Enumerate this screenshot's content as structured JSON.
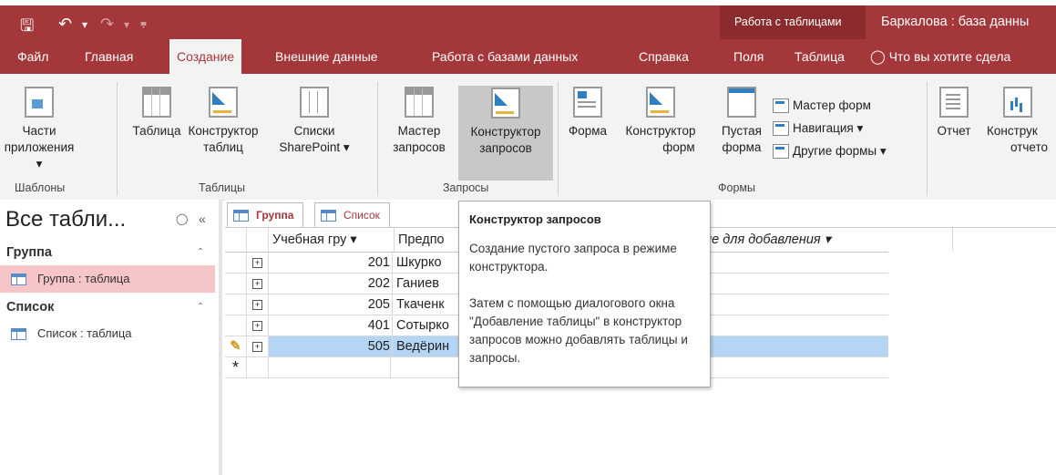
{
  "title_bar": {
    "contextual_group": "Работа с таблицами",
    "document_title": "Баркалова : база данны"
  },
  "tabs": [
    {
      "label": "Файл"
    },
    {
      "label": "Главная"
    },
    {
      "label": "Создание",
      "active": true
    },
    {
      "label": "Внешние данные"
    },
    {
      "label": "Работа с базами данных"
    },
    {
      "label": "Справка"
    },
    {
      "label": "Поля"
    },
    {
      "label": "Таблица"
    }
  ],
  "tell_me": "Что вы хотите сдела",
  "ribbon": {
    "templates": {
      "group": "Шаблоны",
      "app_parts": {
        "line1": "Части",
        "line2": "приложения ▾"
      }
    },
    "tables": {
      "group": "Таблицы",
      "table": "Таблица",
      "table_design": {
        "line1": "Конструктор",
        "line2": "таблиц"
      },
      "sharepoint": {
        "line1": "Списки",
        "line2": "SharePoint ▾"
      }
    },
    "queries": {
      "group": "Запросы",
      "wizard": {
        "line1": "Мастер",
        "line2": "запросов"
      },
      "design": {
        "line1": "Конструктор",
        "line2": "запросов"
      }
    },
    "forms": {
      "group": "Формы",
      "form": "Форма",
      "form_design": {
        "line1": "Конструктор",
        "line2": "форм"
      },
      "blank": {
        "line1": "Пустая",
        "line2": "форма"
      },
      "wizard": "Мастер форм",
      "navigation": "Навигация ▾",
      "more": "Другие формы ▾"
    },
    "reports": {
      "report": "Отчет",
      "report_design": {
        "line1": "Конструк",
        "line2": "отчето"
      }
    }
  },
  "nav_pane": {
    "title": "Все табли...",
    "sections": [
      {
        "name": "Группа",
        "items": [
          "Группа : таблица"
        ]
      },
      {
        "name": "Список",
        "items": [
          "Список : таблица"
        ]
      }
    ]
  },
  "doc_tabs": [
    "Группа",
    "Список"
  ],
  "grid": {
    "headers": [
      "Учебная гру ▾",
      "Предпо",
      "",
      "ле для добавления ▾"
    ],
    "rows": [
      {
        "group": "201",
        "name": "Шкурко"
      },
      {
        "group": "202",
        "name": "Ганиев"
      },
      {
        "group": "205",
        "name": "Ткаченк"
      },
      {
        "group": "401",
        "name": "Сотырко"
      },
      {
        "group": "505",
        "name": "Ведёрин"
      }
    ],
    "new_row_marker": "*",
    "edit_marker": "✎"
  },
  "tooltip": {
    "title": "Конструктор запросов",
    "para1": "Создание пустого запроса в режиме конструктора.",
    "para2": "Затем с помощью диалогового окна \"Добавление таблицы\" в конструктор запросов можно добавлять таблицы и запросы."
  },
  "colors": {
    "accent": "#a4373a",
    "selected_row": "#b4d5f3",
    "nav_selected": "#f6c5c8"
  }
}
